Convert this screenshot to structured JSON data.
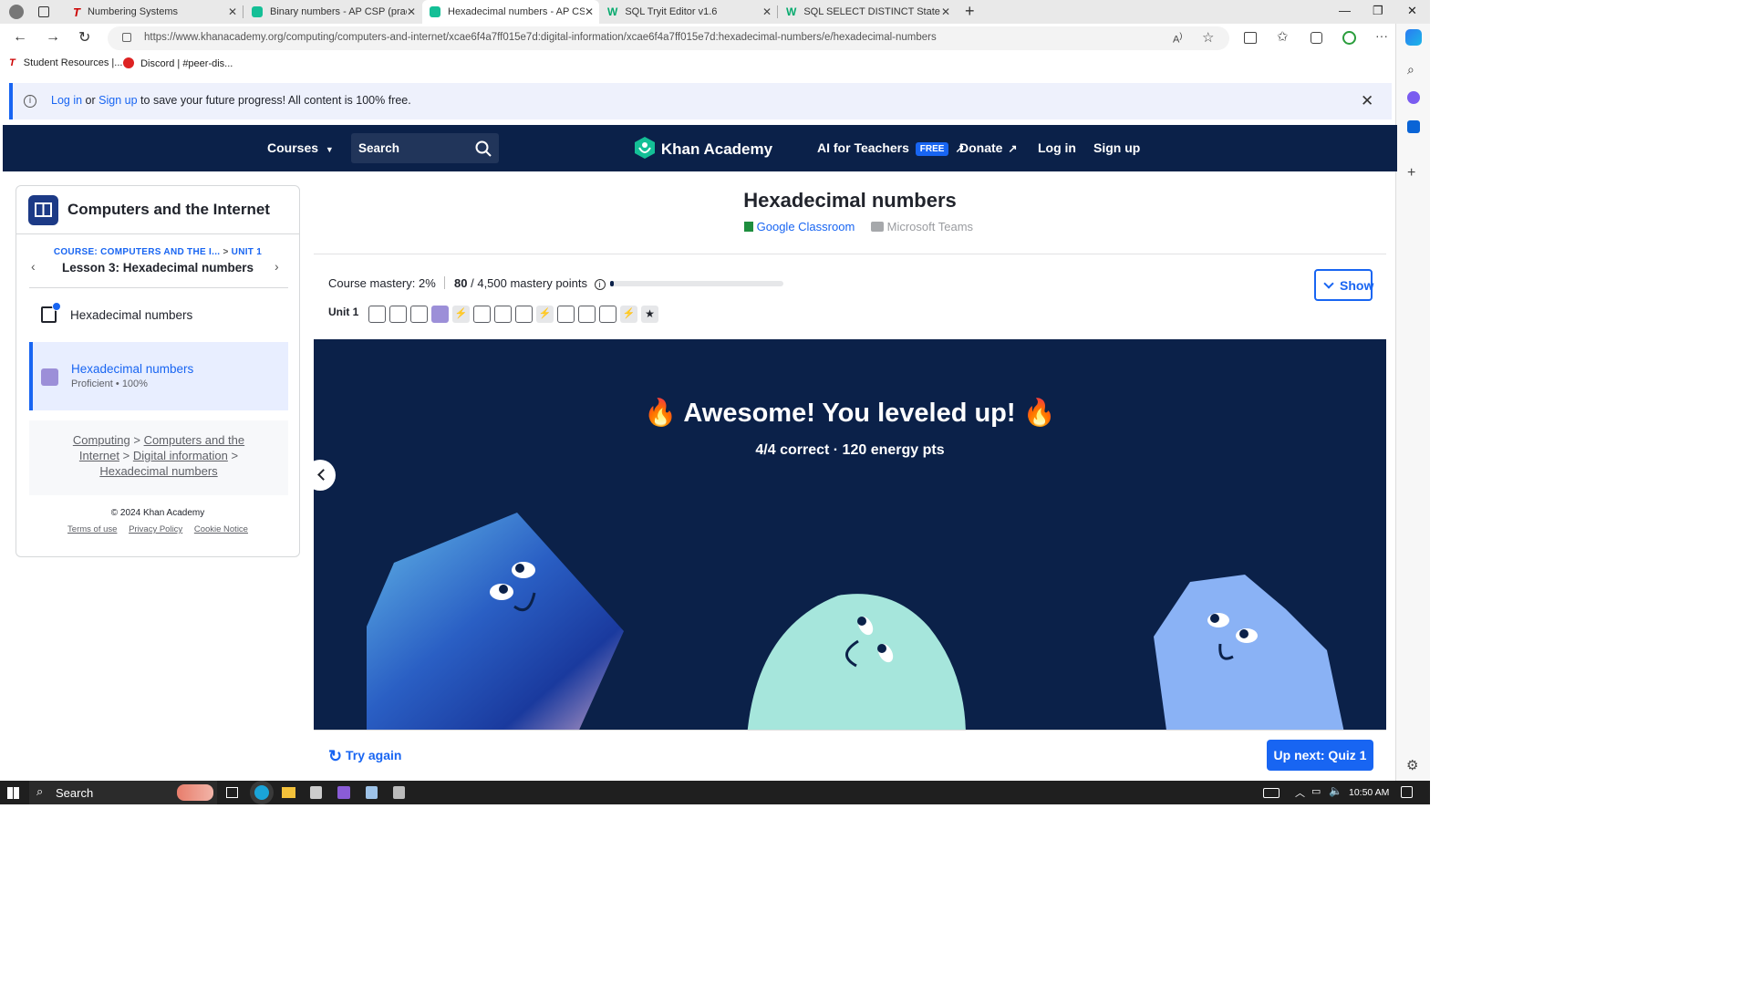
{
  "browser": {
    "tabs": [
      {
        "title": "Numbering Systems",
        "active": false
      },
      {
        "title": "Binary numbers - AP CSP (practic",
        "active": false
      },
      {
        "title": "Hexadecimal numbers - AP CSP (",
        "active": true
      },
      {
        "title": "SQL Tryit Editor v1.6",
        "active": false
      },
      {
        "title": "SQL SELECT DISTINCT Statement",
        "active": false
      }
    ],
    "url": "https://www.khanacademy.org/computing/computers-and-internet/xcae6f4a7ff015e7d:digital-information/xcae6f4a7ff015e7d:hexadecimal-numbers/e/hexadecimal-numbers",
    "bookmarks": [
      "Student Resources |...",
      "Discord | #peer-dis..."
    ]
  },
  "banner": {
    "login": "Log in",
    "or": "or",
    "signup": "Sign up",
    "rest": "to save your future progress! All content is 100% free."
  },
  "nav": {
    "courses": "Courses",
    "search_placeholder": "Search",
    "logo": "Khan Academy",
    "ai_teachers": "AI for Teachers",
    "free": "FREE",
    "donate": "Donate",
    "login": "Log in",
    "signup": "Sign up"
  },
  "sidebar": {
    "course_title": "Computers and the Internet",
    "breadcrumb_course": "COURSE: COMPUTERS AND THE I...",
    "breadcrumb_unit": "UNIT 1",
    "lesson": "Lesson 3: Hexadecimal numbers",
    "items": [
      {
        "label": "Hexadecimal numbers"
      },
      {
        "label": "Hexadecimal numbers",
        "status": "Proficient • 100%"
      }
    ],
    "path": {
      "computing": "Computing",
      "computers": "Computers and the Internet",
      "digital": "Digital information",
      "hex": "Hexadecimal numbers"
    },
    "copyright": "© 2024 Khan Academy",
    "terms": "Terms of use",
    "privacy": "Privacy Policy",
    "cookie": "Cookie Notice"
  },
  "main": {
    "title": "Hexadecimal numbers",
    "google_classroom": "Google Classroom",
    "microsoft_teams": "Microsoft Teams",
    "mastery_label": "Course mastery: 2%",
    "points": "80",
    "points_total": "/ 4,500 mastery points",
    "mastery_fraction": 0.02,
    "unit_label": "Unit 1",
    "show_button": "Show",
    "unit_boxes": [
      "empty",
      "empty",
      "empty",
      "filled",
      "bolt",
      "empty",
      "empty",
      "empty",
      "bolt",
      "empty",
      "empty",
      "empty",
      "bolt",
      "star"
    ]
  },
  "result": {
    "headline": "Awesome! You leveled up!",
    "subline": "4/4 correct · 120 energy pts"
  },
  "footer": {
    "try_again": "Try again",
    "up_next": "Up next: Quiz 1"
  },
  "taskbar": {
    "search": "Search",
    "time": "10:50 AM"
  },
  "colors": {
    "navy": "#0b2149",
    "blue": "#1865f2",
    "mastery_purple": "#9c8fd8"
  }
}
